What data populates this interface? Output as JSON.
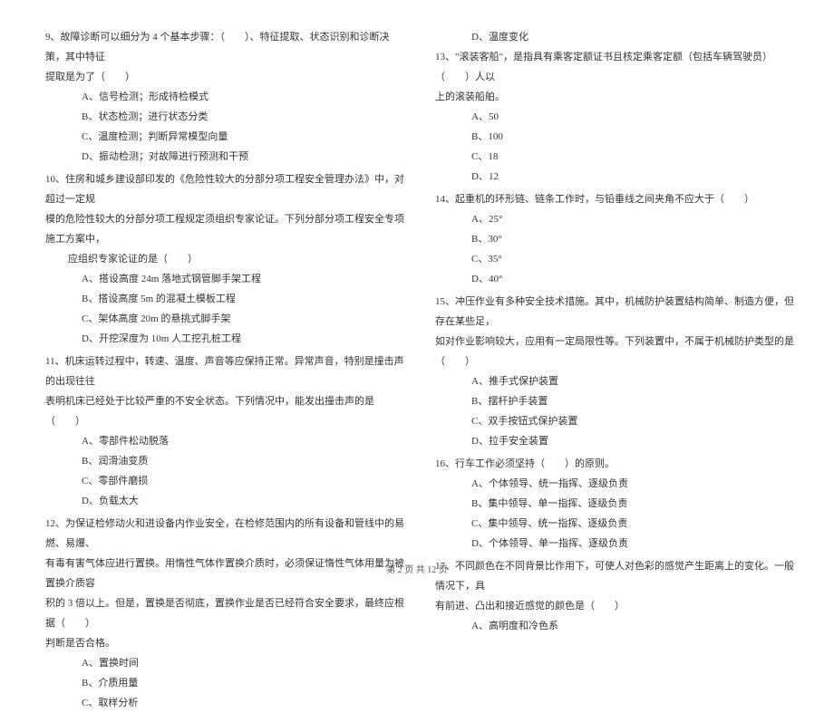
{
  "left_column": {
    "q9": {
      "text": "9、故障诊断可以细分为 4 个基本步骤：（　　）、特征提取、状态识别和诊断决策，其中特征",
      "cont": "提取是为了（　　）",
      "options": [
        "A、信号检测；形成待检模式",
        "B、状态检测；进行状态分类",
        "C、温度检测；判断异常模型向量",
        "D、振动检测；对故障进行预测和干预"
      ]
    },
    "q10": {
      "text": "10、住房和城乡建设部印发的《危险性较大的分部分项工程安全管理办法》中，对超过一定规",
      "cont1": "模的危险性较大的分部分项工程规定须组织专家论证。下列分部分项工程安全专项施工方案中，",
      "cont2": "应组织专家论证的是（　　）",
      "options": [
        "A、搭设高度 24m 落地式钢管脚手架工程",
        "B、搭设高度 5m 的混凝土模板工程",
        "C、架体高度 20m 的悬挑式脚手架",
        "D、开挖深度为 10m 人工挖孔桩工程"
      ]
    },
    "q11": {
      "text": "11、机床运转过程中，转速、温度、声音等应保持正常。异常声音，特别是撞击声的出现往往",
      "cont": "表明机床已经处于比较严重的不安全状态。下列情况中，能发出撞击声的是（　　）",
      "options": [
        "A、零部件松动脱落",
        "B、润滑油变质",
        "C、零部件磨损",
        "D、负载太大"
      ]
    },
    "q12": {
      "text": "12、为保证检修动火和进设备内作业安全，在检修范围内的所有设备和管线中的易燃、易爆、",
      "cont1": "有毒有害气体应进行置换。用惰性气体作置换介质时，必须保证惰性气体用量为被置换介质容",
      "cont2": "积的 3 倍以上。但是，置换是否彻底，置换作业是否已经符合安全要求，最终应根据（　　）",
      "cont3": "判断是否合格。",
      "options": [
        "A、置换时间",
        "B、介质用量",
        "C、取样分析"
      ]
    }
  },
  "right_column": {
    "q12d": "D、温度变化",
    "q13": {
      "text": "13、\"滚装客船\"，是指具有乘客定额证书且核定乘客定额（包括车辆驾驶员）（　　）人以",
      "cont": "上的滚装船舶。",
      "options": [
        "A、50",
        "B、100",
        "C、18",
        "D、12"
      ]
    },
    "q14": {
      "text": "14、起重机的环形链、链条工作时，与铅垂线之间夹角不应大于（　　）",
      "options": [
        "A、25°",
        "B、30°",
        "C、35°",
        "D、40°"
      ]
    },
    "q15": {
      "text": "15、冲压作业有多种安全技术措施。其中，机械防护装置结构简单、制造方便，但存在某些足，",
      "cont": "如对作业影响较大，应用有一定局限性等。下列装置中，不属于机械防护类型的是（　　）",
      "options": [
        "A、推手式保护装置",
        "B、摆杆护手装置",
        "C、双手按钮式保护装置",
        "D、拉手安全装置"
      ]
    },
    "q16": {
      "text": "16、行车工作必须坚持（　　）的原则。",
      "options": [
        "A、个体领导、统一指挥、逐级负责",
        "B、集中领导、单一指挥、逐级负责",
        "C、集中领导、统一指挥、逐级负责",
        "D、个体领导、单一指挥、逐级负责"
      ]
    },
    "q17": {
      "text": "17、不同颜色在不同背景比作用下，可使人对色彩的感觉产生距离上的变化。一般情况下，具",
      "cont": "有前进、凸出和接近感觉的颜色是（　　）",
      "options": [
        "A、高明度和冷色系"
      ]
    }
  },
  "footer": "第 2 页 共 12 页"
}
